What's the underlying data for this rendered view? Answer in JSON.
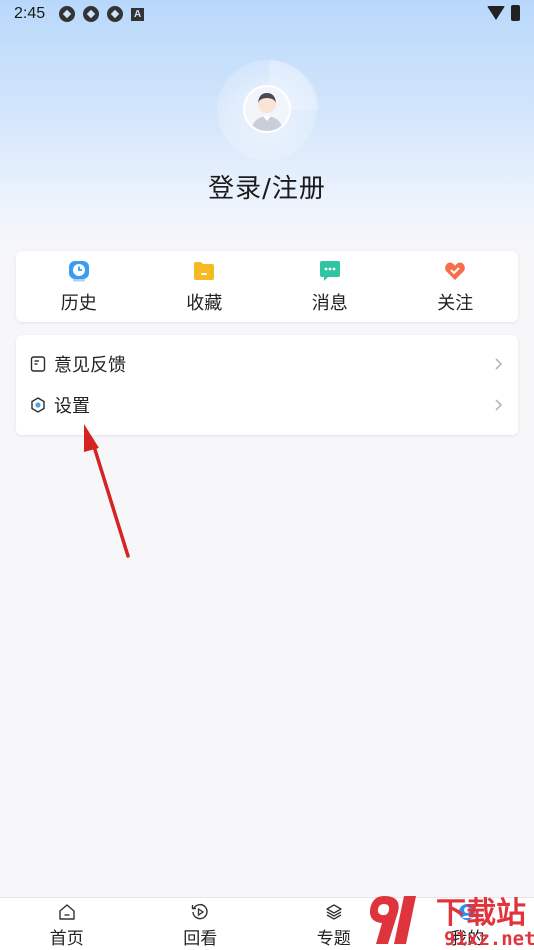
{
  "status_bar": {
    "time": "2:45"
  },
  "profile": {
    "login_label": "登录/注册"
  },
  "quick_actions": [
    {
      "label": "历史",
      "icon": "clock-icon",
      "color": "#3a9cf0"
    },
    {
      "label": "收藏",
      "icon": "folder-icon",
      "color": "#f7b922"
    },
    {
      "label": "消息",
      "icon": "message-icon",
      "color": "#2fc5a0"
    },
    {
      "label": "关注",
      "icon": "heart-icon",
      "color": "#f86d4a"
    }
  ],
  "menu": [
    {
      "label": "意见反馈",
      "icon": "feedback-icon"
    },
    {
      "label": "设置",
      "icon": "settings-icon"
    }
  ],
  "bottom_nav": [
    {
      "label": "首页",
      "icon": "home-icon"
    },
    {
      "label": "回看",
      "icon": "replay-icon"
    },
    {
      "label": "专题",
      "icon": "layers-icon"
    },
    {
      "label": "我的",
      "icon": "profile-icon",
      "active": true
    }
  ],
  "watermark": {
    "text_main": "下载站",
    "text_sub": "91xz.net",
    "brand_color": "#e0343d"
  }
}
